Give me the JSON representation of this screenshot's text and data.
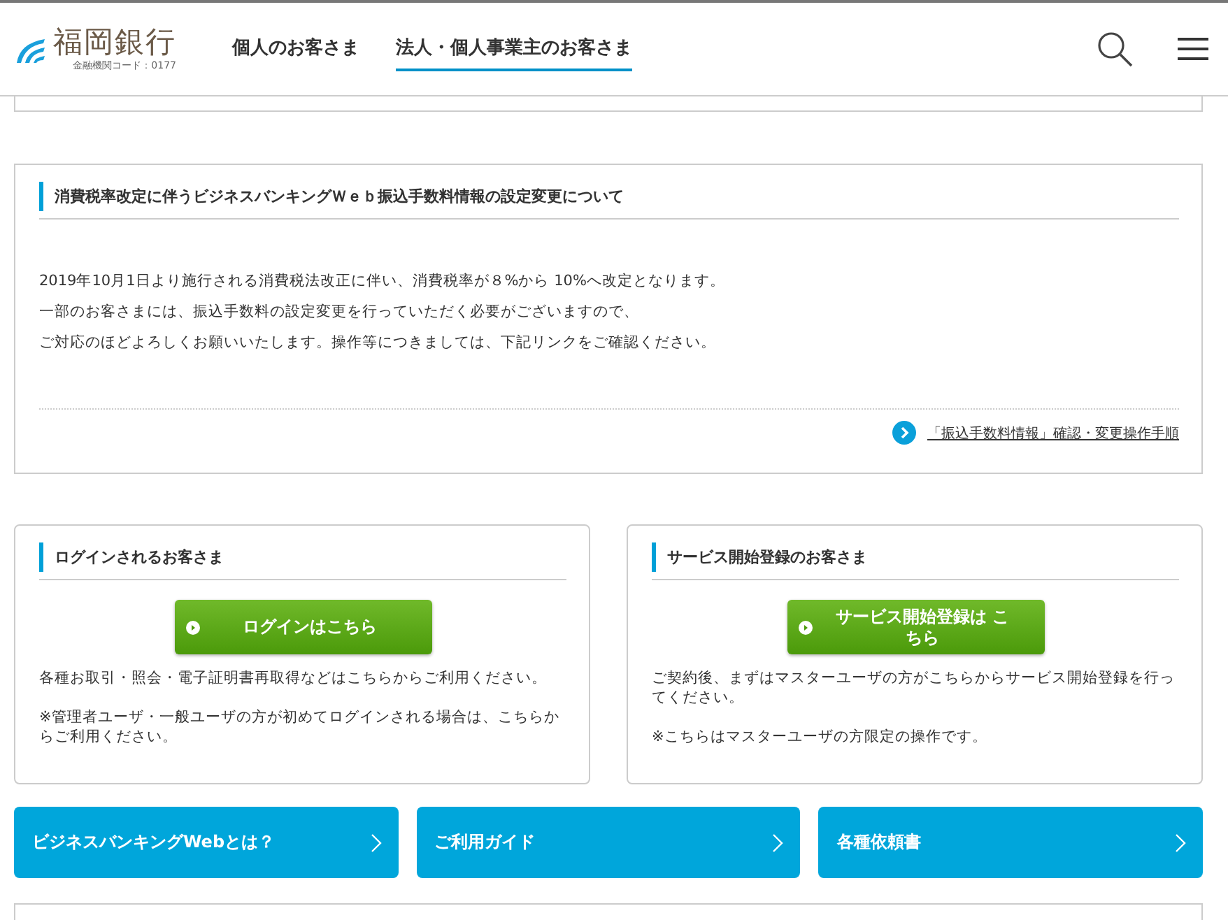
{
  "header": {
    "logo_name": "福岡銀行",
    "bank_code": "金融機関コード：0177",
    "nav": [
      {
        "label": "個人のお客さま",
        "selected": false
      },
      {
        "label": "法人・個人事業主のお客さま",
        "selected": true
      }
    ]
  },
  "notice": {
    "title": "消費税率改定に伴うビジネスバンキングＷｅｂ振込手数料情報の設定変更について",
    "paragraphs": [
      "2019年10月1日より施行される消費税法改正に伴い、消費税率が８%から 10%へ改定となります。",
      "一部のお客さまには、振込手数料の設定変更を行っていただく必要がございますので、",
      "ご対応のほどよろしくお願いいたします。操作等につきましては、下記リンクをご確認ください。"
    ],
    "link": "「振込手数料情報」確認・変更操作手順"
  },
  "cards": [
    {
      "title": "ログインされるお客さま",
      "button": "ログインはこちら",
      "notes": [
        "各種お取引・照会・電子証明書再取得などはこちらからご利用ください。",
        "※管理者ユーザ・一般ユーザの方が初めてログインされる場合は、こちらからご利用ください。"
      ]
    },
    {
      "title": "サービス開始登録のお客さま",
      "button": "サービス開始登録は こちら",
      "notes": [
        "ご契約後、まずはマスターユーザの方がこちらからサービス開始登録を行ってください。",
        "※こちらはマスターユーザの方限定の操作です。"
      ]
    }
  ],
  "menu_buttons": [
    "ビジネスバンキングWebとは？",
    "ご利用ガイド",
    "各種依頼書"
  ]
}
